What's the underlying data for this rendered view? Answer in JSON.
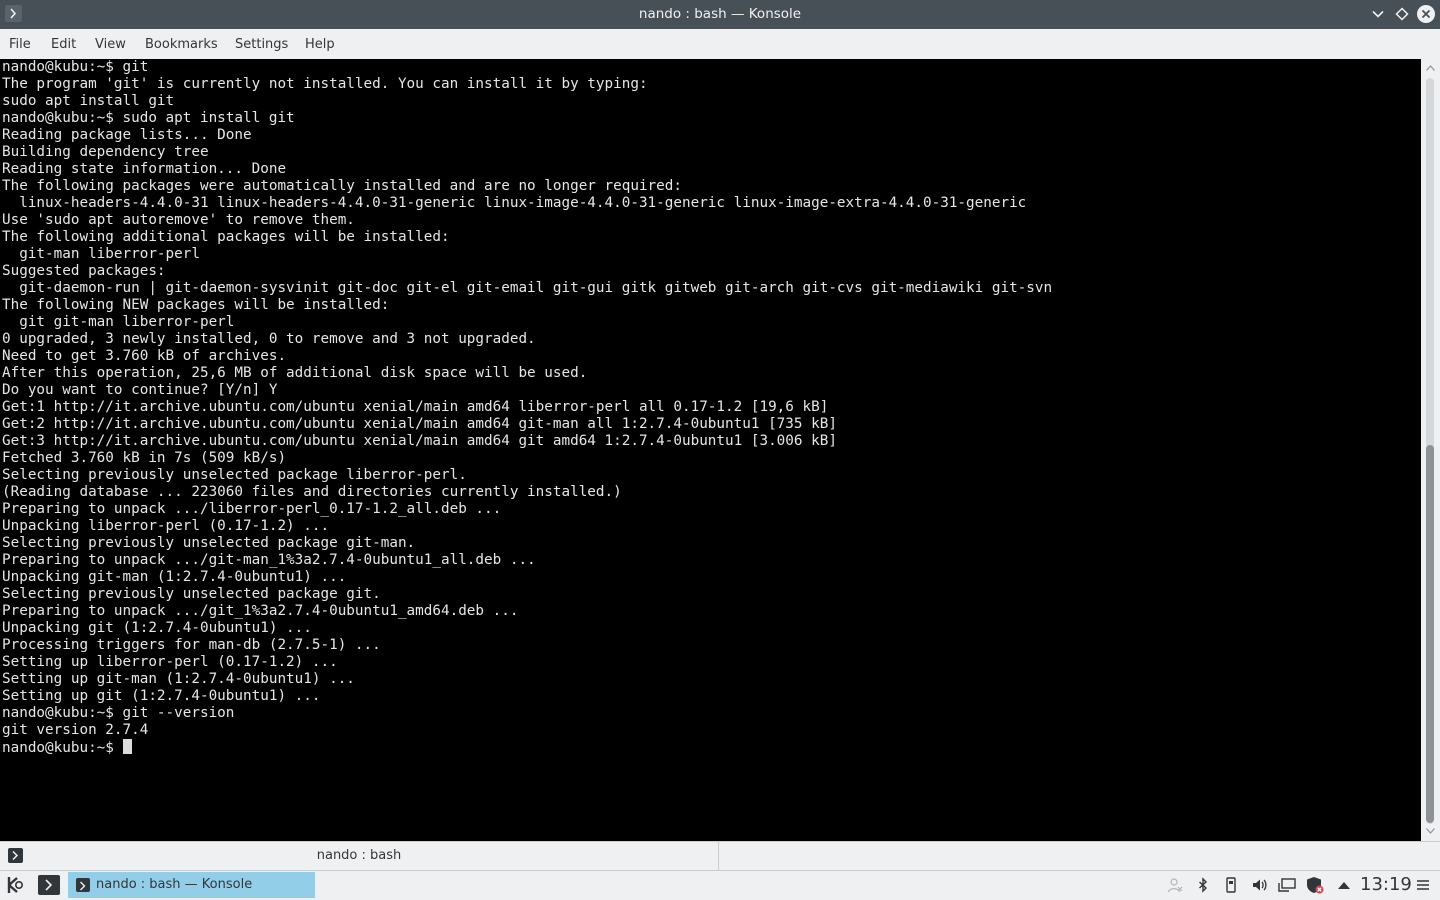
{
  "window": {
    "title": "nando : bash — Konsole"
  },
  "menubar": {
    "items": [
      "File",
      "Edit",
      "View",
      "Bookmarks",
      "Settings",
      "Help"
    ]
  },
  "terminal": {
    "lines": [
      "nando@kubu:~$ git",
      "The program 'git' is currently not installed. You can install it by typing:",
      "sudo apt install git",
      "nando@kubu:~$ sudo apt install git",
      "Reading package lists... Done",
      "Building dependency tree",
      "Reading state information... Done",
      "The following packages were automatically installed and are no longer required:",
      "  linux-headers-4.4.0-31 linux-headers-4.4.0-31-generic linux-image-4.4.0-31-generic linux-image-extra-4.4.0-31-generic",
      "Use 'sudo apt autoremove' to remove them.",
      "The following additional packages will be installed:",
      "  git-man liberror-perl",
      "Suggested packages:",
      "  git-daemon-run | git-daemon-sysvinit git-doc git-el git-email git-gui gitk gitweb git-arch git-cvs git-mediawiki git-svn",
      "The following NEW packages will be installed:",
      "  git git-man liberror-perl",
      "0 upgraded, 3 newly installed, 0 to remove and 3 not upgraded.",
      "Need to get 3.760 kB of archives.",
      "After this operation, 25,6 MB of additional disk space will be used.",
      "Do you want to continue? [Y/n] Y",
      "Get:1 http://it.archive.ubuntu.com/ubuntu xenial/main amd64 liberror-perl all 0.17-1.2 [19,6 kB]",
      "Get:2 http://it.archive.ubuntu.com/ubuntu xenial/main amd64 git-man all 1:2.7.4-0ubuntu1 [735 kB]",
      "Get:3 http://it.archive.ubuntu.com/ubuntu xenial/main amd64 git amd64 1:2.7.4-0ubuntu1 [3.006 kB]",
      "Fetched 3.760 kB in 7s (509 kB/s)",
      "Selecting previously unselected package liberror-perl.",
      "(Reading database ... 223060 files and directories currently installed.)",
      "Preparing to unpack .../liberror-perl_0.17-1.2_all.deb ...",
      "Unpacking liberror-perl (0.17-1.2) ...",
      "Selecting previously unselected package git-man.",
      "Preparing to unpack .../git-man_1%3a2.7.4-0ubuntu1_all.deb ...",
      "Unpacking git-man (1:2.7.4-0ubuntu1) ...",
      "Selecting previously unselected package git.",
      "Preparing to unpack .../git_1%3a2.7.4-0ubuntu1_amd64.deb ...",
      "Unpacking git (1:2.7.4-0ubuntu1) ...",
      "Processing triggers for man-db (2.7.5-1) ...",
      "Setting up liberror-perl (0.17-1.2) ...",
      "Setting up git-man (1:2.7.4-0ubuntu1) ...",
      "Setting up git (1:2.7.4-0ubuntu1) ...",
      "nando@kubu:~$ git --version",
      "git version 2.7.4"
    ],
    "prompt": "nando@kubu:~$ "
  },
  "tabbar": {
    "tab_label": "nando : bash"
  },
  "taskbar": {
    "task_label": "nando : bash — Konsole",
    "clock": "13:19"
  },
  "icons": {
    "app": "konsole-icon",
    "launcher": "kde-launcher-icon",
    "tray": [
      "user-icon",
      "bluetooth-icon",
      "usb-drive-icon",
      "volume-icon",
      "display-icon",
      "updates-shield-icon",
      "expand-tray-icon"
    ]
  },
  "colors": {
    "titlebar": "#475057",
    "terminal_bg": "#000000",
    "terminal_fg": "#e6e6e6",
    "chrome": "#eff0f1",
    "active_task": "#93cee9"
  }
}
